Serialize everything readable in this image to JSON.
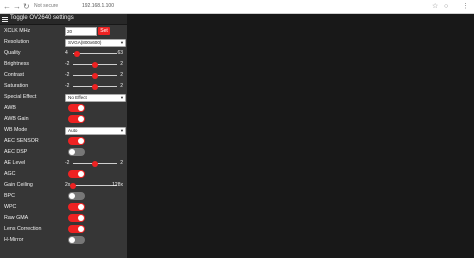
{
  "browser": {
    "nav": {
      "back": "←",
      "forward": "→",
      "reload": "↻"
    },
    "security_label": "Not secure",
    "address": "192.168.1.100",
    "star_icon": "star-icon",
    "menu_icon": "kebab-menu-icon"
  },
  "panel": {
    "title": "Toggle OV2640 settings",
    "xclk": {
      "label": "XCLK MHz",
      "value": "20",
      "button": "Set"
    },
    "resolution": {
      "label": "Resolution",
      "selected": "SVGA(800x600)"
    },
    "quality": {
      "label": "Quality",
      "min": "4",
      "max": "63",
      "value": 10
    },
    "brightness": {
      "label": "Brightness",
      "min": "-2",
      "max": "2",
      "value": 0
    },
    "contrast": {
      "label": "Contrast",
      "min": "-2",
      "max": "2",
      "value": 0
    },
    "saturation": {
      "label": "Saturation",
      "min": "-2",
      "max": "2",
      "value": 0
    },
    "special_effect": {
      "label": "Special Effect",
      "selected": "No Effect"
    },
    "awb": {
      "label": "AWB",
      "on": true
    },
    "awb_gain": {
      "label": "AWB Gain",
      "on": true
    },
    "wb_mode": {
      "label": "WB Mode",
      "selected": "Auto"
    },
    "aec_sensor": {
      "label": "AEC SENSOR",
      "on": true
    },
    "aec_dsp": {
      "label": "AEC DSP",
      "on": false
    },
    "ae_level": {
      "label": "AE Level",
      "min": "-2",
      "max": "2",
      "value": 0
    },
    "agc": {
      "label": "AGC",
      "on": true
    },
    "gain_ceiling": {
      "label": "Gain Ceiling",
      "min": "2x",
      "max": "128x",
      "value": 2
    },
    "bpc": {
      "label": "BPC",
      "on": false
    },
    "wpc": {
      "label": "WPC",
      "on": true
    },
    "raw_gma": {
      "label": "Raw GMA",
      "on": true
    },
    "lens_correction": {
      "label": "Lens Correction",
      "on": true
    },
    "h_mirror": {
      "label": "H-Mirror",
      "on": false
    }
  },
  "colors": {
    "accent": "#ee2222",
    "panel_bg": "#363636",
    "page_bg": "#181818",
    "toggle_off": "#777777"
  }
}
